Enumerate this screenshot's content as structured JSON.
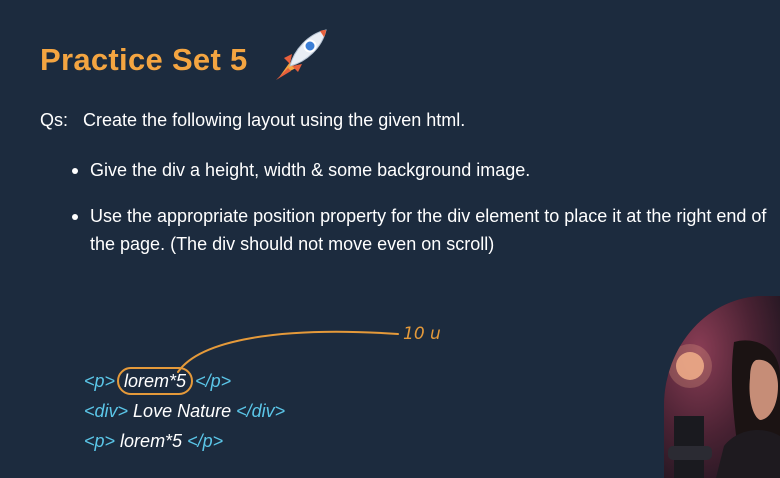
{
  "slide": {
    "title": "Practice Set 5",
    "title_icon": "rocket-icon",
    "question_prefix": "Qs:",
    "question_text": "Create the following layout using the given html.",
    "bullets": [
      "Give the div a height, width & some background image.",
      "Use the appropriate position property for the div element to place it at the right end of the page. (The div should not move even on scroll)"
    ],
    "code": {
      "line1_open": "<p>",
      "line1_text": "lorem*5",
      "line1_close": "</p>",
      "line2_open": "<div>",
      "line2_text": " Love Nature ",
      "line2_close": "</div>",
      "line3_open": "<p>",
      "line3_text": " lorem*5 ",
      "line3_close": "</p>"
    },
    "annotation": "10 u"
  },
  "colors": {
    "background": "#1c2b3e",
    "title": "#f4a541",
    "tag": "#5bc6e8",
    "annotation": "#e59a3a"
  }
}
